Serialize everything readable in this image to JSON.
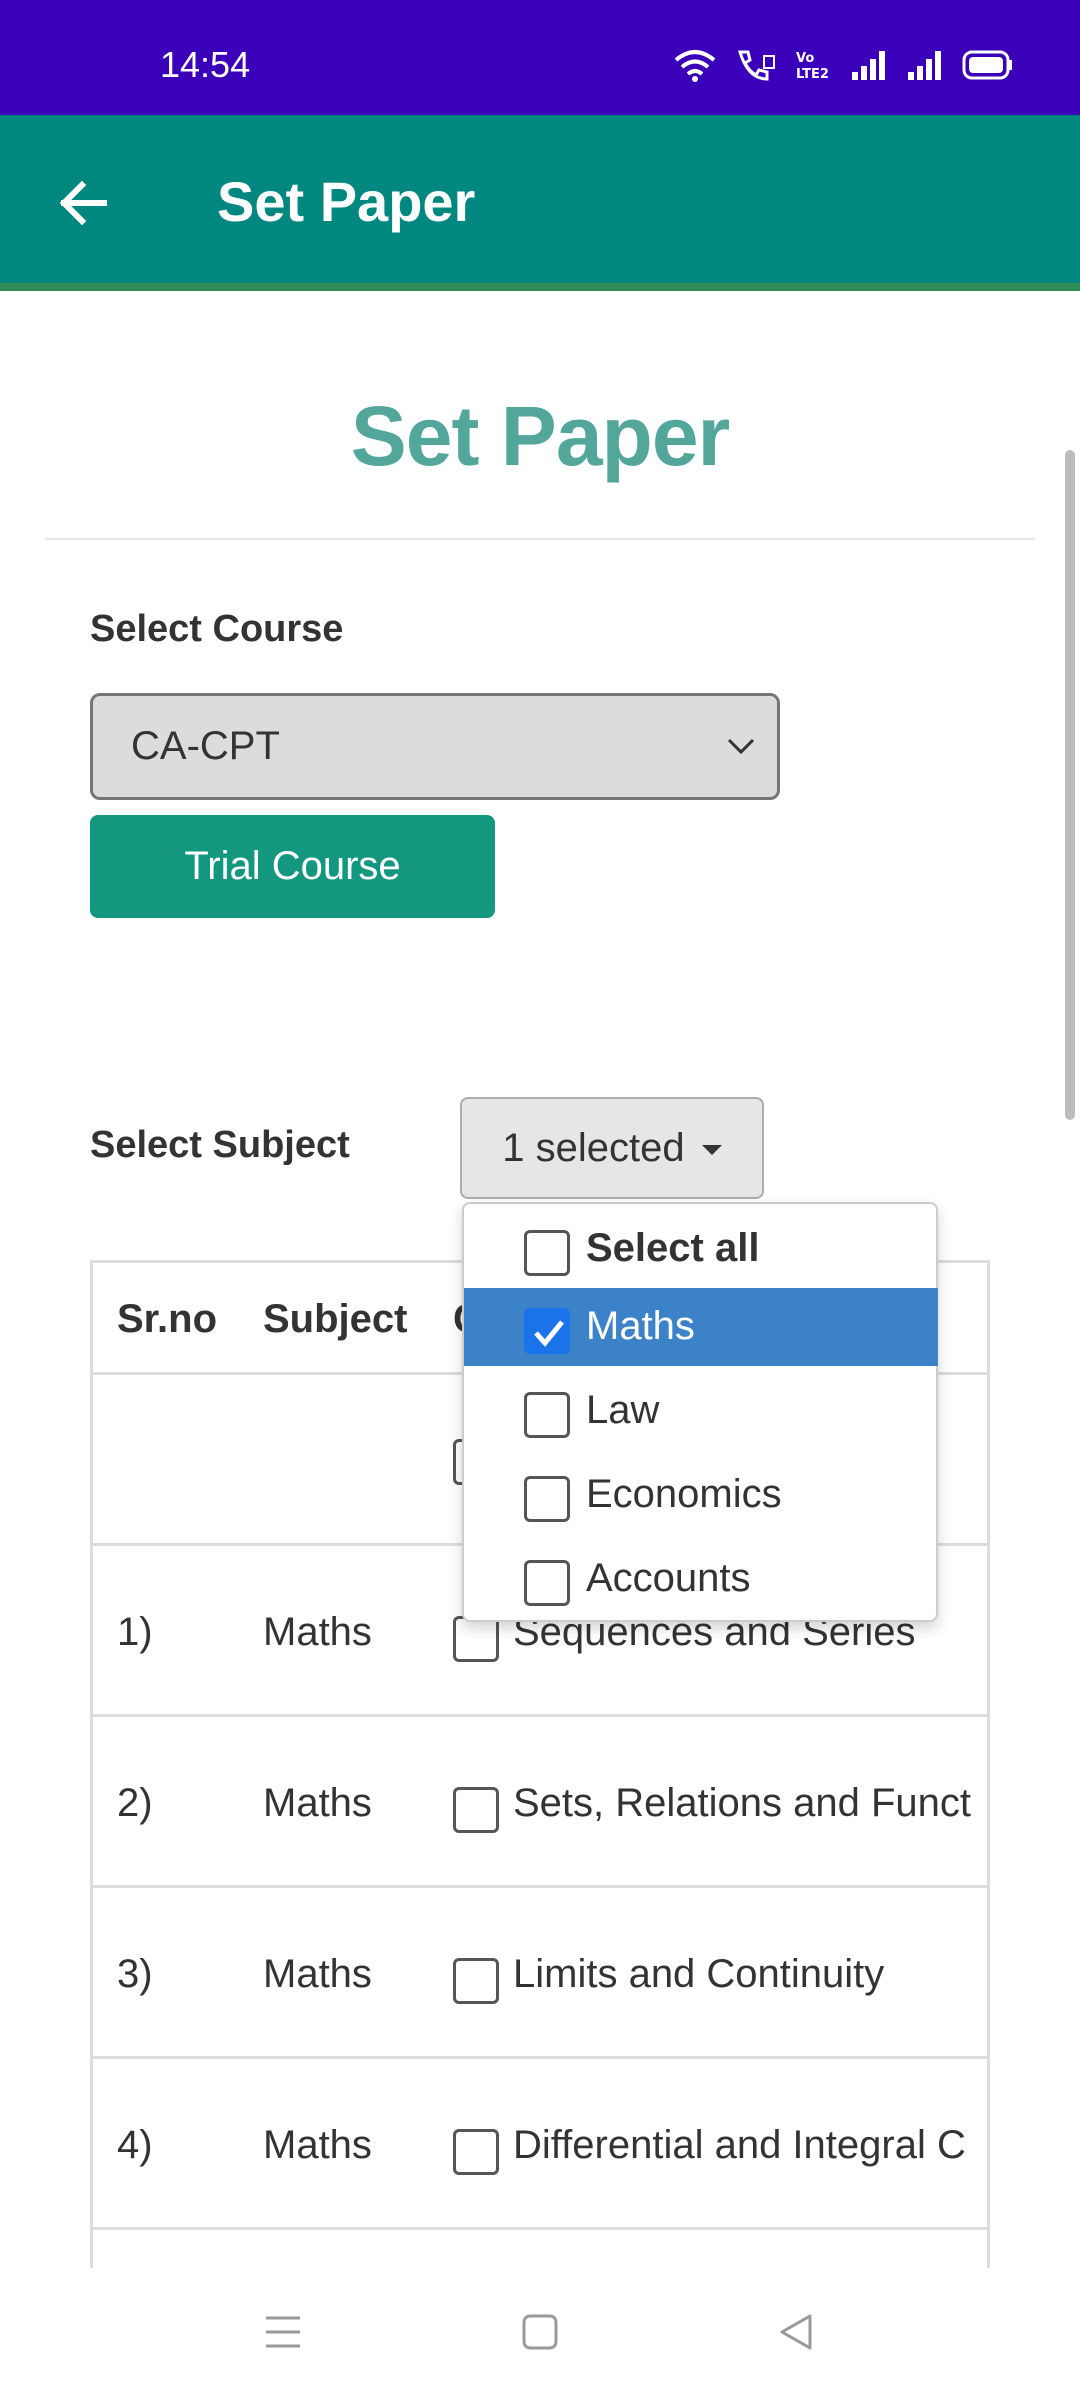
{
  "status": {
    "time": "14:54"
  },
  "appbar": {
    "title": "Set Paper"
  },
  "page": {
    "heading": "Set Paper"
  },
  "course": {
    "label": "Select Course",
    "selected": "CA-CPT",
    "trial_button": "Trial Course"
  },
  "subject": {
    "label": "Select Subject",
    "button_text": "1 selected",
    "options": [
      {
        "label": "Select all",
        "checked": false
      },
      {
        "label": "Maths",
        "checked": true
      },
      {
        "label": "Law",
        "checked": false
      },
      {
        "label": "Economics",
        "checked": false
      },
      {
        "label": "Accounts",
        "checked": false
      }
    ]
  },
  "table": {
    "headers": [
      "Sr.no",
      "Subject",
      "C"
    ],
    "rows": [
      {
        "srno": "1)",
        "subject": "Maths",
        "chapter": "Sequences and Series"
      },
      {
        "srno": "2)",
        "subject": "Maths",
        "chapter": "Sets, Relations and Funct"
      },
      {
        "srno": "3)",
        "subject": "Maths",
        "chapter": "Limits and Continuity"
      },
      {
        "srno": "4)",
        "subject": "Maths",
        "chapter": "Differential and Integral C"
      }
    ]
  }
}
